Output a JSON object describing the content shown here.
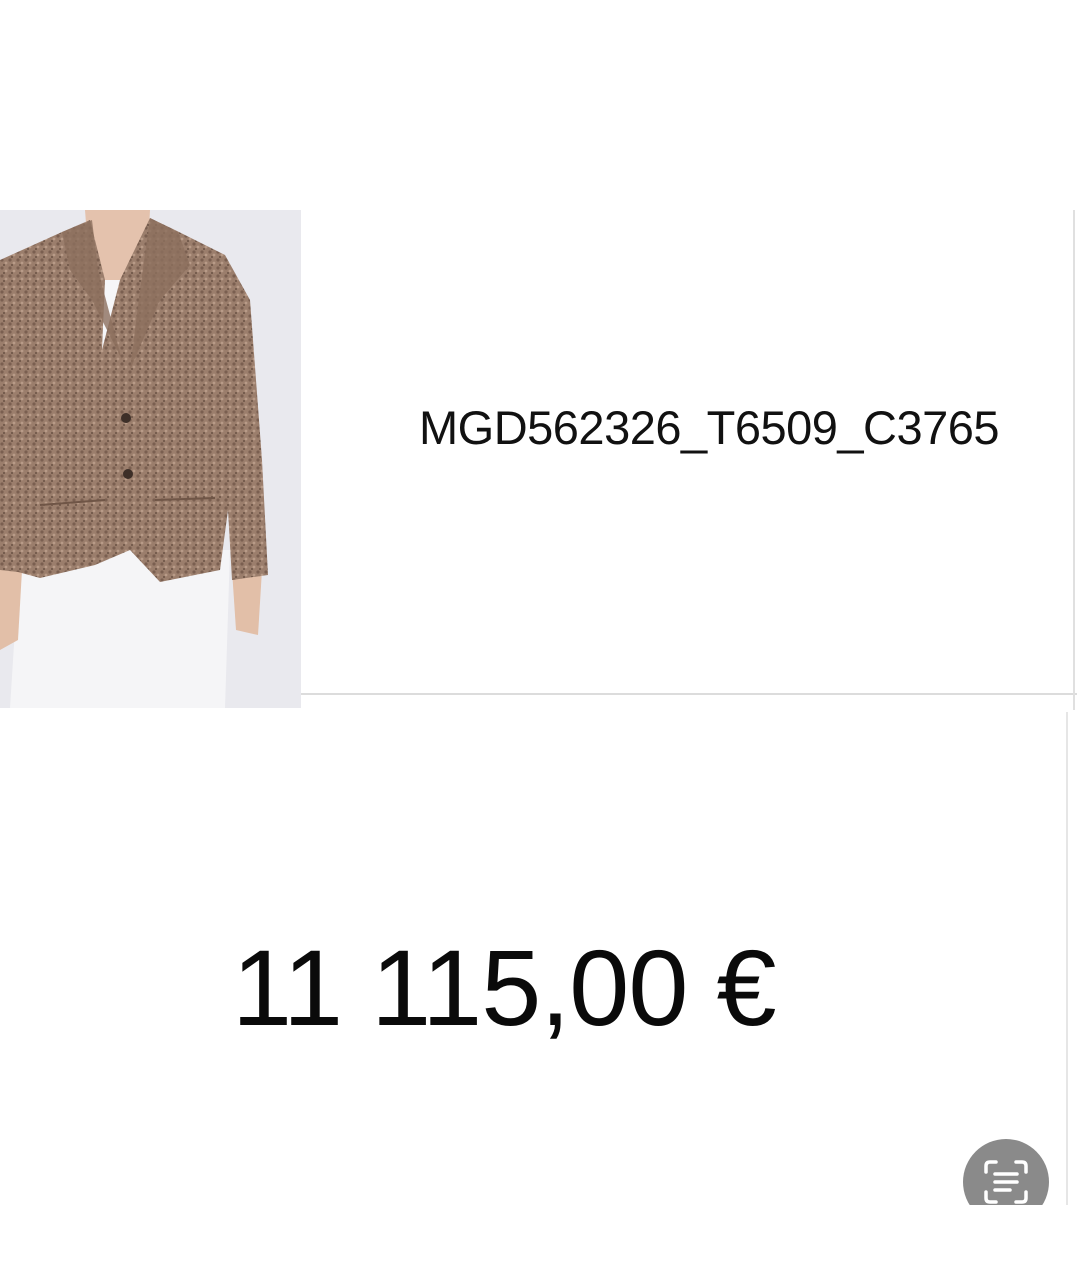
{
  "product": {
    "image_alt": "Jacket photo",
    "sku": "MGD562326_T6509_C3765",
    "price": "11 115,00 €"
  },
  "scan_button": {
    "icon": "text-scan-icon",
    "color": "#8a8a8a"
  }
}
